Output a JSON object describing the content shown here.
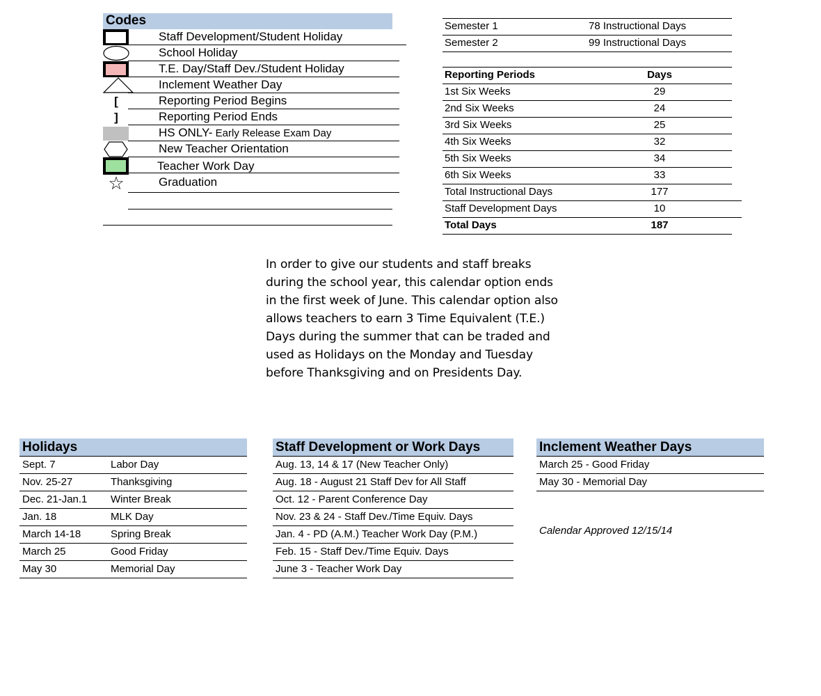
{
  "codes": {
    "title": "Codes",
    "items": [
      {
        "icon": "bold-square-icon",
        "label": "Staff Development/Student Holiday"
      },
      {
        "icon": "oval-icon",
        "label": "School Holiday"
      },
      {
        "icon": "pink-hatched-square-icon",
        "label": "T.E. Day/Staff Dev./Student Holiday"
      },
      {
        "icon": "triangle-icon",
        "label": "Inclement Weather Day"
      },
      {
        "icon": "open-bracket-icon",
        "label": "Reporting Period Begins",
        "glyph": "["
      },
      {
        "icon": "close-bracket-icon",
        "label": "Reporting Period Ends",
        "glyph": "]"
      },
      {
        "icon": "gray-square-icon",
        "label_prefix": "HS ONLY-",
        "label": " Early Release Exam Day"
      },
      {
        "icon": "hexagon-icon",
        "label": "New Teacher Orientation"
      },
      {
        "icon": "green-hatched-square-icon",
        "label": "Teacher Work Day"
      },
      {
        "icon": "star-icon",
        "label": "Graduation",
        "glyph": "☆"
      }
    ],
    "colors": {
      "pink": "#f4b6b6",
      "gray": "#c0c0c0",
      "green": "#9ee09e",
      "header": "#b8cce4"
    }
  },
  "semesters": [
    {
      "name": "Semester 1",
      "value": "78 Instructional Days"
    },
    {
      "name": "Semester 2",
      "value": "99 Instructional Days"
    }
  ],
  "reporting": {
    "header": {
      "name": "Reporting Periods",
      "value": "Days"
    },
    "rows": [
      {
        "name": "1st Six Weeks",
        "value": "29"
      },
      {
        "name": "2nd Six Weeks",
        "value": "24"
      },
      {
        "name": "3rd Six Weeks",
        "value": "25"
      },
      {
        "name": "4th Six Weeks",
        "value": "32"
      },
      {
        "name": "5th Six Weeks",
        "value": "34"
      },
      {
        "name": "6th Six Weeks",
        "value": "33"
      },
      {
        "name": "Total Instructional Days",
        "value": "177"
      },
      {
        "name": "Staff Development Days",
        "value": "10"
      }
    ],
    "total": {
      "name": "Total Days",
      "value": "187"
    }
  },
  "note": "In order to give our students and staff breaks during the school year, this calendar option ends in the first week of June.  This calendar option also allows teachers to earn 3 Time Equivalent (T.E.) Days during the summer that can be traded and used as Holidays on the Monday and Tuesday before Thanksgiving and on Presidents Day.",
  "holidays": {
    "title": "Holidays",
    "rows": [
      {
        "date": "Sept. 7",
        "name": "Labor Day"
      },
      {
        "date": "Nov. 25-27",
        "name": "Thanksgiving"
      },
      {
        "date": "Dec. 21-Jan.1",
        "name": "Winter Break"
      },
      {
        "date": "Jan. 18",
        "name": "MLK Day"
      },
      {
        "date": "March 14-18",
        "name": "Spring Break"
      },
      {
        "date": "March 25",
        "name": "Good Friday"
      },
      {
        "date": "May 30",
        "name": "Memorial Day"
      }
    ]
  },
  "staff_days": {
    "title": "Staff Development or Work Days",
    "rows": [
      "Aug. 13, 14 & 17 (New Teacher Only)",
      "Aug. 18 - August 21 Staff Dev for All Staff",
      "Oct. 12 - Parent Conference Day",
      "Nov. 23 & 24 - Staff Dev./Time Equiv. Days",
      "Jan. 4 - PD (A.M.) Teacher Work Day (P.M.)",
      "Feb. 15 - Staff Dev./Time Equiv. Days",
      "June 3 - Teacher Work Day"
    ]
  },
  "weather_days": {
    "title": "Inclement Weather Days",
    "rows": [
      "March 25 - Good Friday",
      "May 30 - Memorial Day"
    ]
  },
  "approved": "Calendar Approved 12/15/14"
}
